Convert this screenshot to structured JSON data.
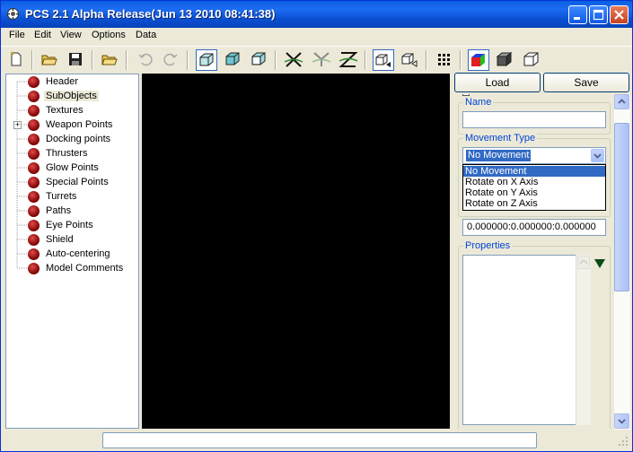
{
  "window": {
    "title": "PCS 2.1 Alpha Release(Jun 13 2010 08:41:38)"
  },
  "menu": [
    "File",
    "Edit",
    "View",
    "Options",
    "Data"
  ],
  "toolbar": {
    "tools": [
      "new-file-icon",
      "open-folder-icon",
      "save-disk-icon",
      "open-folder-icon",
      "undo-icon",
      "redo-icon",
      "wireframe-cube-icon",
      "solid-cube-icon",
      "textured-cube-icon",
      "x-axis-icon",
      "y-axis-icon",
      "z-axis-icon",
      "view-cube-icon",
      "view-cube-alt-icon",
      "grid-icon",
      "color-cube-icon",
      "gray-cube-icon",
      "outline-cube-icon"
    ]
  },
  "tree": {
    "items": [
      {
        "label": "Header"
      },
      {
        "label": "SubObjects",
        "selected": true
      },
      {
        "label": "Textures"
      },
      {
        "label": "Weapon Points",
        "expandable": true
      },
      {
        "label": "Docking points"
      },
      {
        "label": "Thrusters"
      },
      {
        "label": "Glow Points"
      },
      {
        "label": "Special Points"
      },
      {
        "label": "Turrets"
      },
      {
        "label": "Paths"
      },
      {
        "label": "Eye Points"
      },
      {
        "label": "Shield"
      },
      {
        "label": "Auto-centering"
      },
      {
        "label": "Model Comments"
      }
    ]
  },
  "panel": {
    "load_label": "Load",
    "save_label": "Save",
    "name_label": "Name",
    "name_value": "",
    "movement_label": "Movement Type",
    "movement_value": "No Movement",
    "movement_options": [
      "No Movement",
      "Rotate on X Axis",
      "Rotate on Y Axis",
      "Rotate on Z Axis"
    ],
    "vector_value": "0.000000:0.000000:0.000000",
    "properties_label": "Properties",
    "properties_value": ""
  },
  "status": {
    "text": ""
  },
  "colors": {
    "title_bar": "#0a5fe0",
    "selection": "#316ac5",
    "group_label": "#0046d5",
    "viewport": "#000000"
  }
}
